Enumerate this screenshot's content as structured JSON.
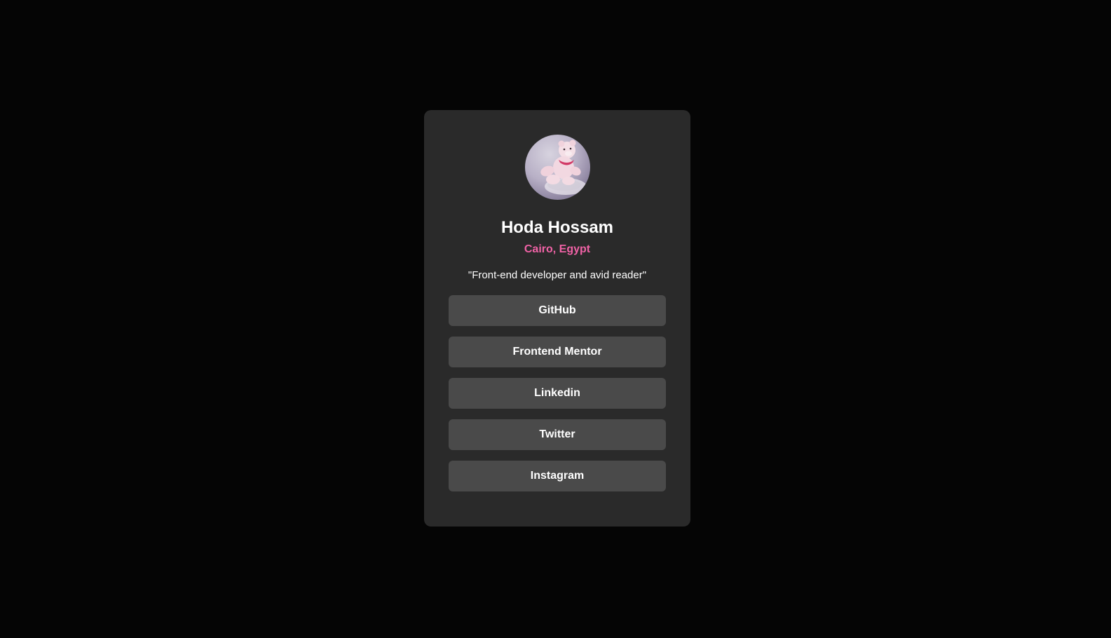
{
  "profile": {
    "name": "Hoda Hossam",
    "location": "Cairo, Egypt",
    "bio": "\"Front-end developer and avid reader\"",
    "avatar_icon": "teddy-bear-photo"
  },
  "links": [
    {
      "label": "GitHub"
    },
    {
      "label": "Frontend Mentor"
    },
    {
      "label": "Linkedin"
    },
    {
      "label": "Twitter"
    },
    {
      "label": "Instagram"
    }
  ],
  "colors": {
    "page_background": "#050505",
    "card_background": "#2a2a2a",
    "button_background": "#4a4a4a",
    "accent": "#f062a6",
    "text": "#ffffff"
  }
}
